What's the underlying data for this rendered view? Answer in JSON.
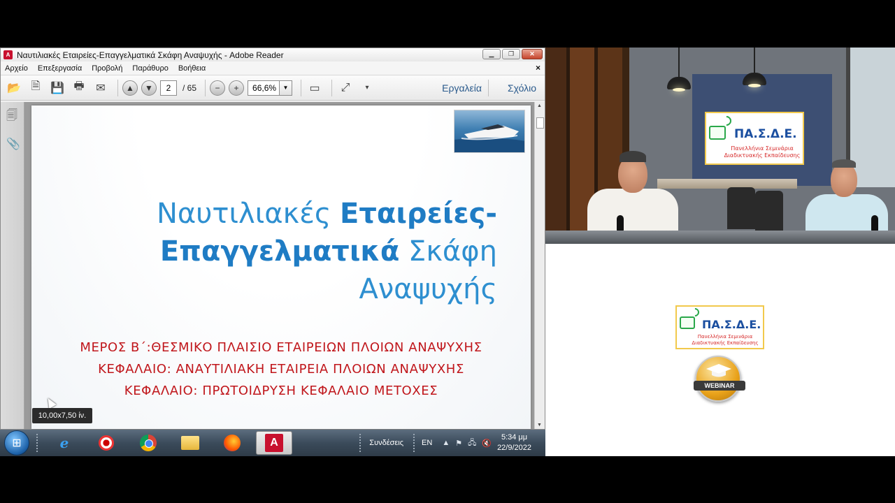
{
  "reader": {
    "window_title": "Ναυτιλιακές Εταιρείες-Επαγγελματικά Σκάφη Αναψυχής - Adobe Reader",
    "menu": [
      "Αρχείο",
      "Επεξεργασία",
      "Προβολή",
      "Παράθυρο",
      "Βοήθεια"
    ],
    "toolbar": {
      "current_page": "2",
      "total_pages": "/ 65",
      "zoom": "66,6%",
      "tools_label": "Εργαλεία",
      "comment_label": "Σχόλιο"
    },
    "document": {
      "title_line1_light": "Ναυτιλιακές ",
      "title_line1_bold": "Εταιρείες-",
      "title_line2_bold": "Επαγγελματικά",
      "title_line2_light": " Σκάφη",
      "title_line3": "Αναψυχής",
      "subtitle1": "ΜΕΡΟΣ Β΄:ΘΕΣΜΙΚΟ ΠΛΑΙΣΙΟ ΕΤΑΙΡΕΙΩΝ ΠΛΟΙΩΝ ΑΝΑΨΥΧΗΣ",
      "subtitle2": "ΚΕΦΑΛΑΙΟ: ΑΝΑΥΤΙΛΙΑΚΗ ΕΤΑΙΡΕΙΑ ΠΛΟΙΩΝ ΑΝΑΨΥΧΗΣ",
      "subtitle3": "ΚΕΦΑΛΑΙΟ: ΠΡΩΤΟΙΔΡΥΣΗ ΚΕΦΑΛΑΙΟ ΜΕΤΟΧΕΣ"
    },
    "tooltip": "10,00x7,50 ίν."
  },
  "taskbar": {
    "connections_label": "Συνδέσεις",
    "language": "EN",
    "time": "5:34 μμ",
    "date": "22/9/2022"
  },
  "logo": {
    "name": "ΠΑ.Σ.Δ.Ε.",
    "tagline_line1": "Πανελλήνια Σεμινάρια",
    "tagline_line2": "Διαδικτυακής Εκπαίδευσης",
    "webinar_label": "WEBINAR"
  },
  "colors": {
    "title_blue": "#2e8fd0",
    "subtitle_red": "#c0161b",
    "logo_blue": "#1b4fa0",
    "logo_red": "#d62828",
    "logo_green": "#2aa84a"
  }
}
